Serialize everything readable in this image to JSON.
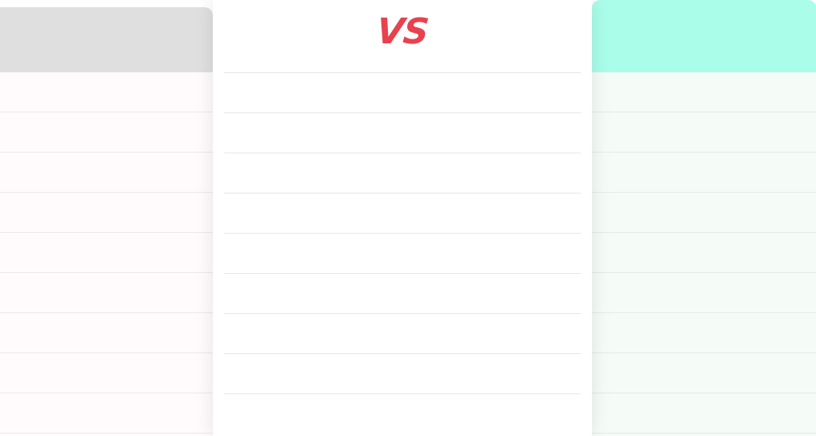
{
  "comparison": {
    "vs_label": "VS",
    "vs_color": "#e8424e",
    "left": {
      "header_color": "#dfdfdf",
      "row_count": 9
    },
    "center": {
      "row_count": 9
    },
    "right": {
      "header_color": "#a9fde9",
      "row_count": 9
    }
  }
}
